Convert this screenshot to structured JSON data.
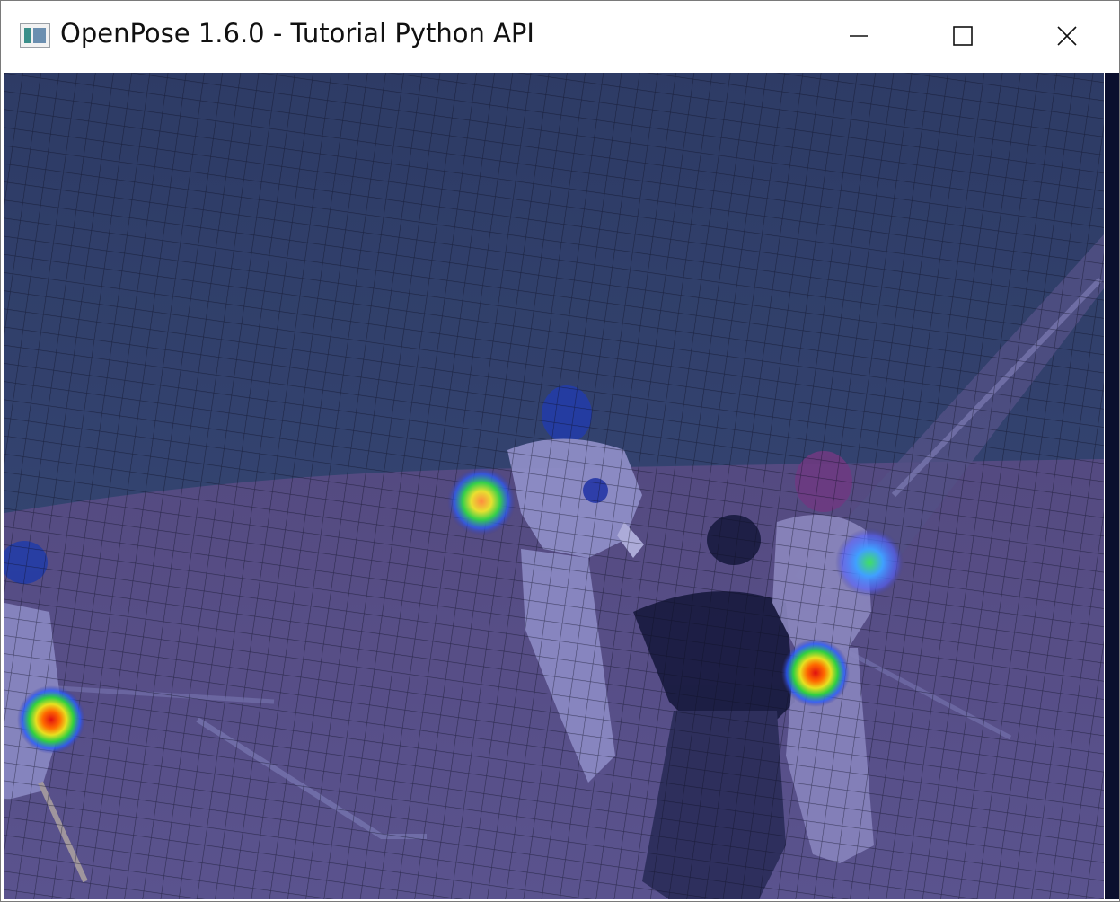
{
  "window": {
    "title": "OpenPose 1.6.0 - Tutorial Python API",
    "app_icon": "window-app-icon",
    "controls": {
      "minimize_icon": "minimize-icon",
      "maximize_icon": "maximize-icon",
      "close_icon": "close-icon"
    }
  },
  "viewport": {
    "content": "baseball scene with heatmap overlay",
    "heatmap_colors": [
      "#0000ff",
      "#00ff00",
      "#ffff00",
      "#ff0000"
    ],
    "tint_color": "#3a3aa0"
  }
}
